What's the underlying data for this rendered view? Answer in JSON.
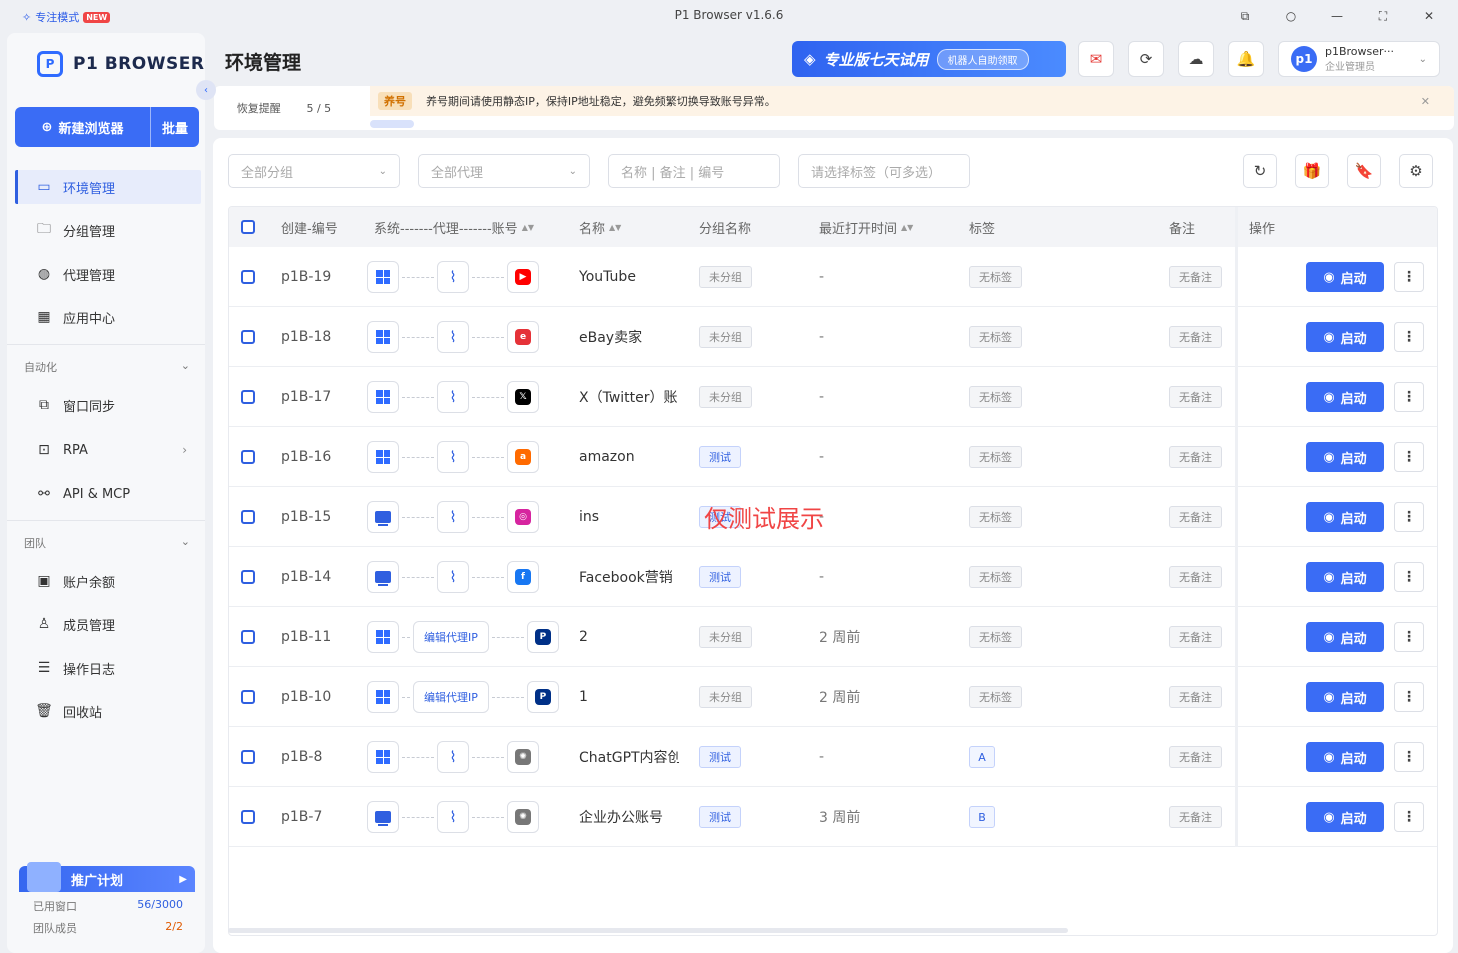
{
  "titlebar": {
    "focus_mode": "专注模式",
    "new_badge": "NEW",
    "app_title": "P1 Browser v1.6.6"
  },
  "sidebar": {
    "logo_text": "P1 BROWSER",
    "new_browser": "新建浏览器",
    "batch": "批量",
    "nav": [
      {
        "label": "环境管理",
        "icon": "window-icon"
      },
      {
        "label": "分组管理",
        "icon": "folder-icon"
      },
      {
        "label": "代理管理",
        "icon": "globe-icon"
      },
      {
        "label": "应用中心",
        "icon": "grid-icon"
      }
    ],
    "automation_label": "自动化",
    "automation": [
      {
        "label": "窗口同步",
        "icon": "sync-window-icon"
      },
      {
        "label": "RPA",
        "icon": "robot-icon"
      },
      {
        "label": "API & MCP",
        "icon": "plug-icon"
      }
    ],
    "team_label": "团队",
    "team": [
      {
        "label": "账户余额",
        "icon": "wallet-icon"
      },
      {
        "label": "成员管理",
        "icon": "member-icon"
      },
      {
        "label": "操作日志",
        "icon": "log-icon"
      },
      {
        "label": "回收站",
        "icon": "trash-icon"
      }
    ],
    "promo": {
      "title": "推广计划",
      "windows_label": "已用窗口",
      "windows_value": "56/3000",
      "members_label": "团队成员",
      "members_value": "2/2"
    }
  },
  "header": {
    "title": "环境管理",
    "trial_text": "专业版七天试用",
    "trial_pill": "机器人自助领取",
    "user_name": "p1Browser···",
    "user_role": "企业管理员",
    "avatar_text": "p1"
  },
  "notice": {
    "recover_label": "恢复提醒",
    "count": "5 / 5",
    "tag": "养号",
    "text": "养号期间请使用静态IP，保持IP地址稳定，避免频繁切换导致账号异常。"
  },
  "filters": {
    "group": "全部分组",
    "proxy": "全部代理",
    "search_placeholder": "名称 | 备注 | 编号",
    "tags": "请选择标签（可多选）"
  },
  "table": {
    "headers": {
      "id": "创建-编号",
      "sys": "系统-------代理-------账号",
      "name": "名称",
      "group": "分组名称",
      "last_open": "最近打开时间",
      "tags": "标签",
      "remark": "备注",
      "ops": "操作"
    },
    "start_label": "启动",
    "rows": [
      {
        "id": "p1B-19",
        "os": "windows",
        "proxy": "",
        "site": "youtube",
        "name": "YouTube",
        "group": "未分组",
        "group_type": "gray",
        "last": "-",
        "tag": "无标签",
        "tag_type": "gray",
        "remark": "无备注"
      },
      {
        "id": "p1B-18",
        "os": "windows",
        "proxy": "",
        "site": "ebay",
        "name": "eBay卖家",
        "group": "未分组",
        "group_type": "gray",
        "last": "-",
        "tag": "无标签",
        "tag_type": "gray",
        "remark": "无备注"
      },
      {
        "id": "p1B-17",
        "os": "windows",
        "proxy": "",
        "site": "x",
        "name": "X（Twitter）账",
        "group": "未分组",
        "group_type": "gray",
        "last": "-",
        "tag": "无标签",
        "tag_type": "gray",
        "remark": "无备注"
      },
      {
        "id": "p1B-16",
        "os": "windows",
        "proxy": "",
        "site": "amazon",
        "name": "amazon",
        "group": "测试",
        "group_type": "blue",
        "last": "-",
        "tag": "无标签",
        "tag_type": "gray",
        "remark": "无备注"
      },
      {
        "id": "p1B-15",
        "os": "mac",
        "proxy": "",
        "site": "instagram",
        "name": "ins",
        "group": "测试",
        "group_type": "blue",
        "last": "-",
        "tag": "无标签",
        "tag_type": "gray",
        "remark": "无备注"
      },
      {
        "id": "p1B-14",
        "os": "mac",
        "proxy": "",
        "site": "facebook",
        "name": "Facebook营销",
        "group": "测试",
        "group_type": "blue",
        "last": "-",
        "tag": "无标签",
        "tag_type": "gray",
        "remark": "无备注"
      },
      {
        "id": "p1B-11",
        "os": "windows",
        "proxy": "编辑代理IP",
        "site": "paypal",
        "name": "2",
        "group": "未分组",
        "group_type": "gray",
        "last": "2 周前",
        "tag": "无标签",
        "tag_type": "gray",
        "remark": "无备注"
      },
      {
        "id": "p1B-10",
        "os": "windows",
        "proxy": "编辑代理IP",
        "site": "paypal",
        "name": "1",
        "group": "未分组",
        "group_type": "gray",
        "last": "2 周前",
        "tag": "无标签",
        "tag_type": "gray",
        "remark": "无备注"
      },
      {
        "id": "p1B-8",
        "os": "windows",
        "proxy": "",
        "site": "chatgpt",
        "name": "ChatGPT内容创",
        "group": "测试",
        "group_type": "blue",
        "last": "-",
        "tag": "A",
        "tag_type": "letter",
        "remark": "无备注"
      },
      {
        "id": "p1B-7",
        "os": "mac",
        "proxy": "",
        "site": "chatgpt",
        "name": "企业办公账号",
        "group": "测试",
        "group_type": "blue",
        "last": "3 周前",
        "tag": "B",
        "tag_type": "letter",
        "remark": "无备注"
      }
    ]
  },
  "watermark": "仅测试展示",
  "site_colors": {
    "youtube": "#ff0000",
    "ebay": "#e53238",
    "x": "#000000",
    "amazon": "#ff6a00",
    "instagram": "#d6249f",
    "facebook": "#1877f2",
    "paypal": "#003087",
    "chatgpt": "#777777"
  }
}
